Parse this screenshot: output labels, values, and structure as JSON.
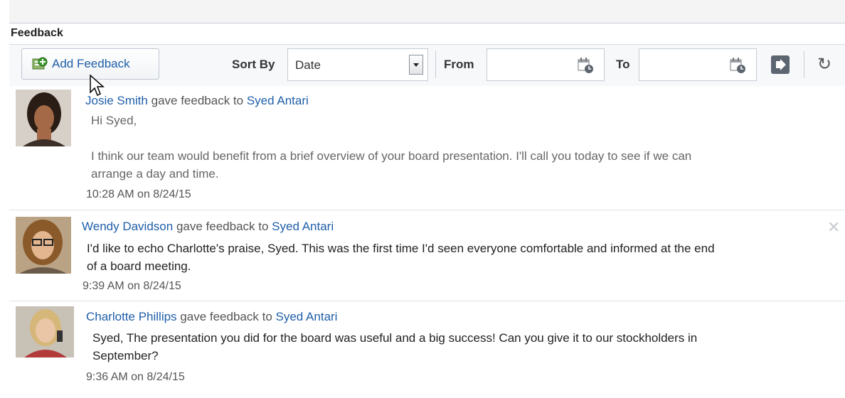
{
  "section": {
    "title": "Feedback"
  },
  "toolbar": {
    "add_label": "Add Feedback",
    "sort_label": "Sort By",
    "sort_value": "Date",
    "from_label": "From",
    "to_label": "To",
    "from_value": "",
    "to_value": ""
  },
  "feedback": [
    {
      "author": "Josie Smith",
      "action": "gave feedback to",
      "recipient": "Syed Antari",
      "body": [
        "Hi Syed,",
        "",
        "I think our team would benefit from a brief overview of your board presentation. I'll call you today to see if we can",
        "arrange a day and time."
      ],
      "time": "10:28 AM on 8/24/15"
    },
    {
      "author": "Wendy Davidson",
      "action": "gave feedback to",
      "recipient": "Syed Antari",
      "body": [
        "I'd like to echo Charlotte's praise, Syed. This was the first time I'd seen everyone comfortable and informed at the end",
        "of a board meeting."
      ],
      "time": "9:39 AM on 8/24/15"
    },
    {
      "author": "Charlotte Phillips",
      "action": "gave feedback to",
      "recipient": "Syed Antari",
      "body": [
        "Syed, The presentation you did for the board was useful and a big success! Can you give it to our stockholders in",
        "September?"
      ],
      "time": "9:36 AM on 8/24/15"
    }
  ],
  "icons": {
    "add": "add-feedback-icon",
    "calendar": "calendar-icon",
    "go": "go-arrow-icon",
    "refresh": "refresh-icon",
    "close": "close-icon",
    "cursor": "mouse-cursor-icon"
  }
}
